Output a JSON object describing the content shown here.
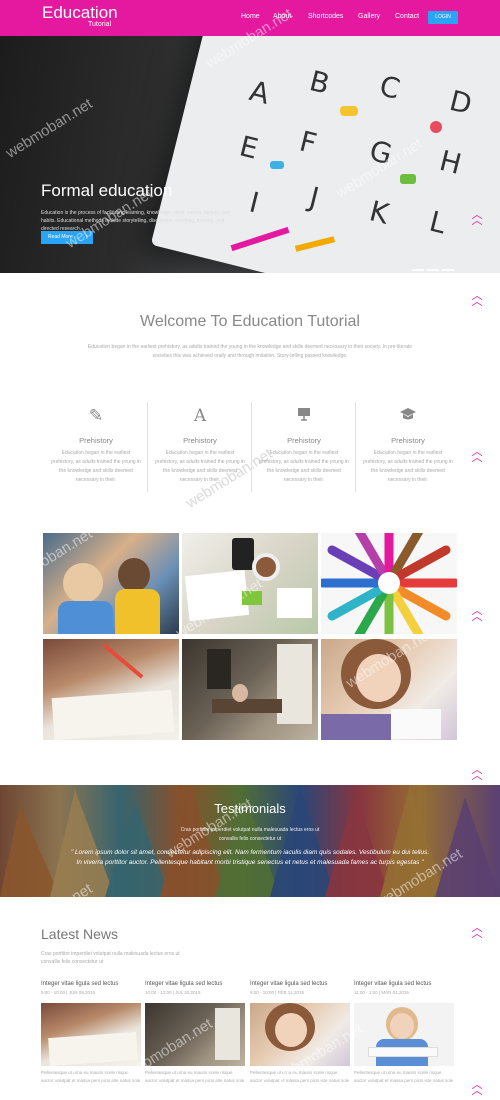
{
  "header": {
    "logo_main": "Education",
    "logo_sub": "Tutorial",
    "nav": [
      "Home",
      "About",
      "Shortcodes",
      "Gallery",
      "Contact"
    ],
    "login": "LOGIN",
    "brand_color": "#e5199f"
  },
  "hero": {
    "title": "Formal education",
    "text": "Education is the process of facilitating learning, knowledge, skills, values, beliefs, and habits. Educational methods include storytelling, discussion, teaching, training, and directed research.",
    "button": "Read More",
    "letters": [
      "A",
      "B",
      "C",
      "D",
      "E",
      "F",
      "G",
      "H",
      "I",
      "J",
      "K",
      "L"
    ]
  },
  "welcome": {
    "title": "Welcome To Education Tutorial",
    "text": "Education began in the earliest prehistory, as adults trained the young in the knowledge and skills deemed necessary in their society. In pre-literate societies this was achieved orally and through imitation. Story-telling passed knowledge."
  },
  "features": [
    {
      "icon": "pencil-icon",
      "title": "Prehistory",
      "text": "Education began in the earliest prehistory, as adults trained the young in the knowledge and skills deemed necessary in their."
    },
    {
      "icon": "letter-a-icon",
      "title": "Prehistory",
      "text": "Education began in the earliest prehistory, as adults trained the young in the knowledge and skills deemed necessary in their."
    },
    {
      "icon": "presentation-icon",
      "title": "Prehistory",
      "text": "Education began in the earliest prehistory, as adults trained the young in the knowledge and skills deemed necessary in their."
    },
    {
      "icon": "graduation-cap-icon",
      "title": "Prehistory",
      "text": "Education began in the earliest prehistory, as adults trained the young in the knowledge and skills deemed necessary in their."
    }
  ],
  "testimonials": {
    "title": "Testimonials",
    "sub": "Cras porttitor imperdiet volutpat nulla malesuada lectus eros ut convallis felis consectetur ut",
    "quote": "\" Lorem ipsum dolor sit amet, consectetur adipiscing elit. Nam fermentum iaculis diam quis sodales. Vestibulum eu dui tellus. In viverra porttitor auctor. Pellentesque habitant morbi tristique senectus et netus et malesuada fames ac turpis egestas \""
  },
  "news": {
    "title": "Latest News",
    "sub": "Cras porttitor imperdiet volutpat nulla malesuada lectus eros ut convallis felis consectetur ut",
    "items": [
      {
        "title": "Integer vitae ligula sed lectus",
        "date": "9:00 - 10:00 | JUN 09,2015",
        "text": "Pellentesque ut urna eu mauris scele risque auctor volutpat et massa pers picis iste natus sole"
      },
      {
        "title": "Integer vitae ligula sed lectus",
        "date": "10:00 - 12:00 | JUL 20,2015",
        "text": "Pellentesque ut urna eu mauris scele risque auctor volutpat et massa pers picis iste natus sole"
      },
      {
        "title": "Integer vitae ligula sed lectus",
        "date": "9:00 - 10:00 | FEB 12,2015",
        "text": "Pellentesque ut urna eu mauris scele risque auctor volutpat et massa pers picis iste natus sole"
      },
      {
        "title": "Integer vitae ligula sed lectus",
        "date": "11:00 - 1:00 | MAR 01,2015",
        "text": "Pellentesque ut urna eu mauris scele risque auctor volutpat et massa pers picis iste natus sole"
      }
    ]
  },
  "watermark": "webmoban.net"
}
